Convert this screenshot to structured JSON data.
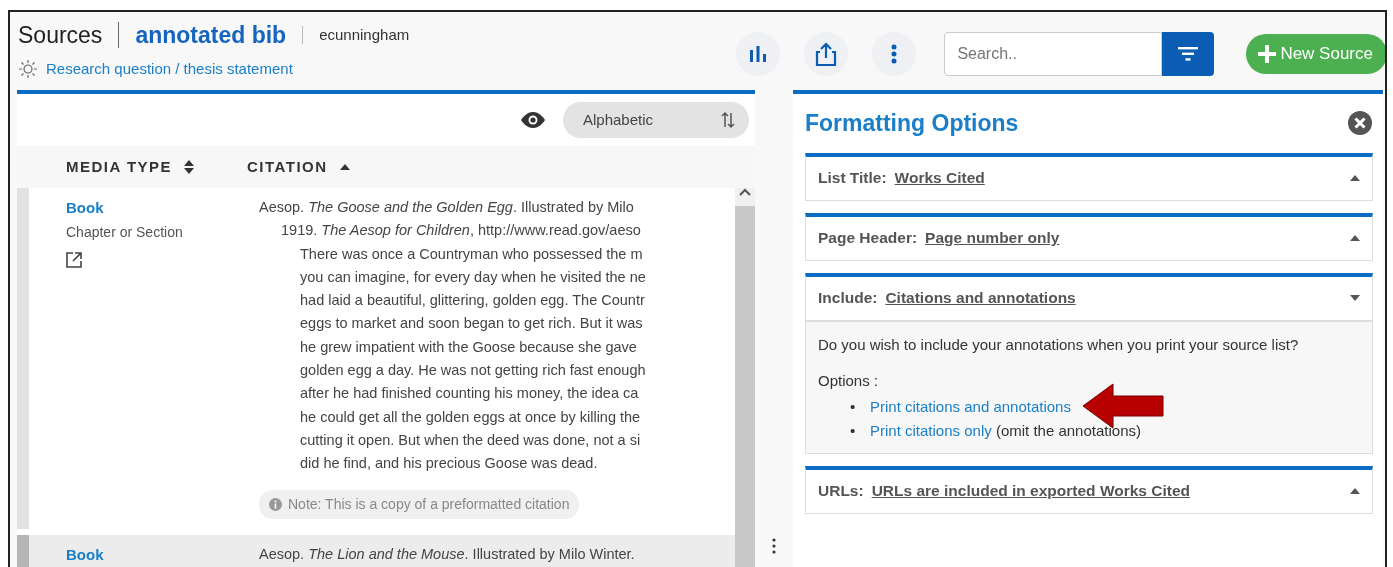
{
  "header": {
    "title": "Sources",
    "project": "annotated bib",
    "user": "ecunningham",
    "research_link": "Research question / thesis statement"
  },
  "toolbar": {
    "search": {
      "placeholder": "Search.."
    },
    "new_button": "New Source"
  },
  "sources_panel": {
    "sort_label": "Alphabetic",
    "columns": [
      {
        "label": "MEDIA TYPE",
        "sorted": false
      },
      {
        "label": "CITATION",
        "sorted": true
      }
    ],
    "rows": [
      {
        "media_type": "Book",
        "subtype": "Chapter or Section",
        "selected": false,
        "citation_lines": [
          "Aesop. *The Goose and the Golden Egg*. Illustrated by Milo",
          "1919. *The Aesop for Children*, http://www.read.gov/aeso"
        ],
        "annotation_lines": [
          "There was once a Countryman who possessed the m",
          "you can imagine, for every day when he visited the ne",
          "had laid a beautiful, glittering, golden egg. The Countr",
          "eggs to market and soon began to get rich. But it was",
          "he grew impatient with the Goose because she gave",
          "golden egg a day. He was not getting rich fast enough",
          "after he had finished counting his money, the idea ca",
          "he could get all the golden eggs at once by killing the",
          "cutting it open. But when the deed was done, not a si",
          "did he find, and his precious Goose was dead."
        ],
        "note": "Note: This is a copy of a preformatted citation"
      },
      {
        "media_type": "Book",
        "selected": true,
        "citation_lines": [
          "Aesop. *The Lion and the Mouse*. Illustrated by Milo Winter."
        ]
      }
    ]
  },
  "formatting": {
    "title": "Formatting Options",
    "sections": [
      {
        "label": "List Title:",
        "value": "Works Cited",
        "expanded": false
      },
      {
        "label": "Page Header:",
        "value": "Page number only",
        "expanded": false
      },
      {
        "label": "Include:",
        "value": "Citations and annotations",
        "expanded": true,
        "question": "Do you wish to include your annotations when you print your source list?",
        "options_label": "Options :",
        "options": [
          {
            "bullet": "•",
            "link": "Print citations and annotations"
          },
          {
            "bullet": "•",
            "link": "Print citations only",
            "note": "(omit the annotations)"
          }
        ]
      },
      {
        "label": "URLs:",
        "value": "URLs are included in exported Works Cited",
        "expanded": false
      }
    ]
  }
}
